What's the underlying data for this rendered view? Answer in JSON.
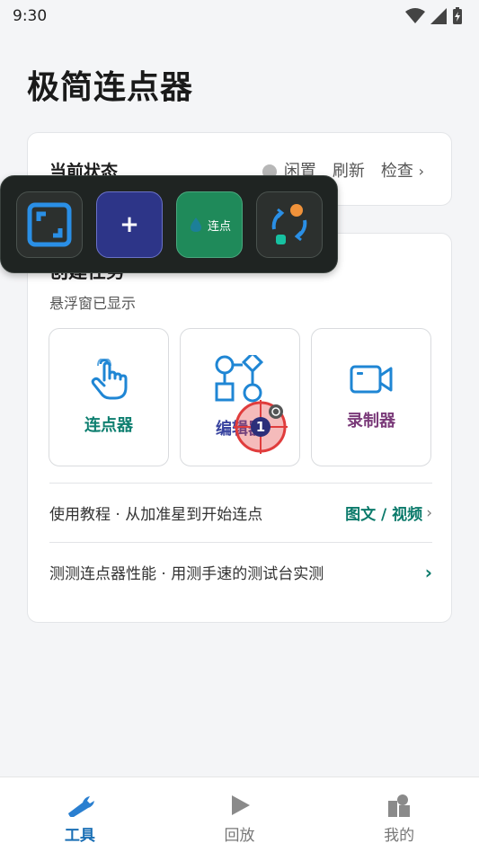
{
  "status_bar": {
    "time": "9:30"
  },
  "page": {
    "title": "极简连点器"
  },
  "status_card": {
    "label": "当前状态",
    "state": "闲置",
    "refresh": "刷新",
    "check": "检查",
    "check_chevron": "›"
  },
  "task_card": {
    "title": "创建任务",
    "subtitle": "悬浮窗已显示",
    "tools": [
      {
        "label": "连点器",
        "color": "#0e7f70",
        "icon": "tap-hand-icon"
      },
      {
        "label": "编辑器",
        "color": "#3a45a0",
        "icon": "flowchart-icon"
      },
      {
        "label": "录制器",
        "color": "#7b3b7a",
        "icon": "video-camera-icon"
      }
    ],
    "tutorial": {
      "text": "使用教程 · 从加准星到开始连点",
      "link": "图文 / 视频",
      "chevron": "›"
    },
    "benchmark": {
      "text": "测测连点器性能 · 用测手速的测试台实测",
      "chevron": "›"
    }
  },
  "floating_bar": {
    "buttons": [
      {
        "icon": "expand-icon"
      },
      {
        "label": "+"
      },
      {
        "label": "连点"
      },
      {
        "icon": "sync-icon"
      }
    ],
    "crosshair_index": "1"
  },
  "bottom_nav": {
    "items": [
      {
        "label": "工具",
        "active": true
      },
      {
        "label": "回放",
        "active": false
      },
      {
        "label": "我的",
        "active": false
      }
    ]
  }
}
